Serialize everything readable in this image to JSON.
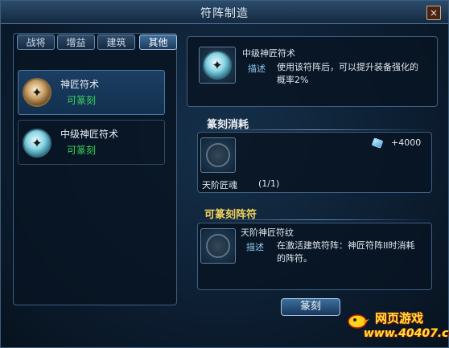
{
  "window": {
    "title": "符阵制造",
    "close_symbol": "×"
  },
  "tabs": [
    {
      "label": "战将",
      "active": false
    },
    {
      "label": "增益",
      "active": false
    },
    {
      "label": "建筑",
      "active": false
    },
    {
      "label": "其他",
      "active": true
    }
  ],
  "list": [
    {
      "name": "神匠符术",
      "status": "可篆刻",
      "icon": "rune-gold-icon",
      "selected": true
    },
    {
      "name": "中级神匠符术",
      "status": "可篆刻",
      "icon": "rune-blue-icon",
      "selected": false
    }
  ],
  "detail": {
    "name": "中级神匠符术",
    "desc_label": "描述",
    "desc_line1": "使用该符阵后，可以提升装备强化的",
    "desc_line2": "概率2%"
  },
  "cost": {
    "title": "篆刻消耗",
    "material_name": "天阶匠魂",
    "material_count": "(1/1)",
    "currency_amount": "+4000",
    "currency_icon": "gem-icon"
  },
  "craftable": {
    "title": "可篆刻阵符",
    "name": "天阶神匠符纹",
    "desc_label": "描述",
    "desc_line1": "在激活建筑符阵：神匠符阵II时消耗",
    "desc_line2": "的阵符。"
  },
  "action": {
    "label": "篆刻"
  },
  "watermark": {
    "site": "网页游戏",
    "url": "www.40407.com"
  },
  "colors": {
    "status_green": "#38d25c",
    "section_gold": "#f2d45c",
    "desc_blue": "#8fc7f0"
  }
}
